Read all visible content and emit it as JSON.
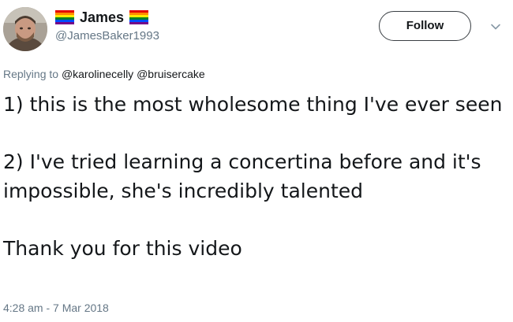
{
  "author": {
    "display_name": "James",
    "handle": "@JamesBaker1993",
    "name_flag_icon": "rainbow-flag-icon",
    "avatar_icon": "user-avatar"
  },
  "follow_button": {
    "label": "Follow"
  },
  "menu_icon": "chevron-down-icon",
  "reply": {
    "prefix": "Replying to",
    "mentions": [
      "@karolinecelly",
      "@bruisercake"
    ]
  },
  "tweet": {
    "paragraphs": [
      "1) this is the most wholesome thing I've ever seen",
      "2) I've tried learning a concertina before and it's impossible, she's incredibly talented",
      "Thank you for this video"
    ]
  },
  "timestamp": "4:28 am - 7 Mar 2018",
  "colors": {
    "text": "#14171a",
    "secondary": "#657786",
    "flag_red": "#e40303",
    "flag_orange": "#ff8c00",
    "flag_yellow": "#ffed00",
    "flag_green": "#008026",
    "flag_blue": "#004dff",
    "flag_purple": "#750787"
  }
}
